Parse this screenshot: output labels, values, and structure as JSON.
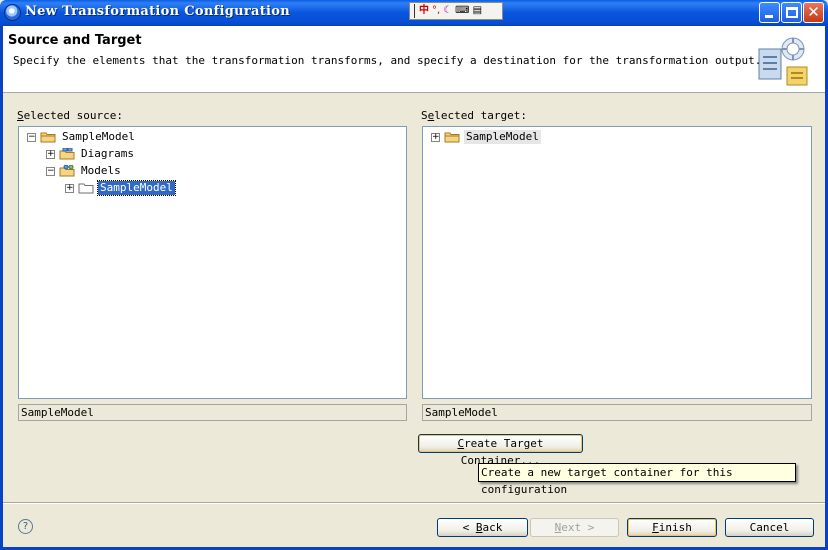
{
  "window": {
    "title": "New Transformation Configuration",
    "ime_icons": [
      "ime-mode-icon",
      "punctuation-icon",
      "moon-icon",
      "keyboard-icon",
      "menu-icon"
    ]
  },
  "header": {
    "title": "Source and Target",
    "description": "Specify the elements that the transformation transforms, and specify a destination for the transformation output."
  },
  "source": {
    "label_mnemonic": "S",
    "label_rest": "elected source:",
    "tree": [
      {
        "label": "SampleModel",
        "expanded": true,
        "level": 0,
        "icon": "project-folder-icon"
      },
      {
        "label": "Diagrams",
        "expanded": false,
        "level": 1,
        "icon": "diagram-folder-icon"
      },
      {
        "label": "Models",
        "expanded": true,
        "level": 1,
        "icon": "model-folder-icon"
      },
      {
        "label": "SampleModel",
        "expanded": false,
        "level": 2,
        "icon": "folder-icon",
        "selected": true
      }
    ],
    "path": "SampleModel"
  },
  "target": {
    "label_pre": "S",
    "label_mnemonic": "e",
    "label_rest": "lected target:",
    "tree": [
      {
        "label": "SampleModel",
        "expanded": false,
        "level": 0,
        "icon": "project-folder-icon"
      }
    ],
    "path": "SampleModel"
  },
  "create_target_button": {
    "mnemonic": "C",
    "rest": "reate Target Container..."
  },
  "tooltip": "Create a new target container for this configuration",
  "footer": {
    "help_glyph": "?",
    "back": {
      "arrow": "<",
      "mnemonic": "B",
      "rest": "ack"
    },
    "next": {
      "mnemonic": "N",
      "rest": "ext",
      "arrow": ">"
    },
    "finish": {
      "mnemonic": "F",
      "rest": "inish"
    },
    "cancel": "Cancel"
  },
  "colors": {
    "titlebar": "#0855dd",
    "selection": "#316ac5",
    "dialog_bg": "#ece9d8",
    "tooltip_bg": "#ffffe1"
  }
}
